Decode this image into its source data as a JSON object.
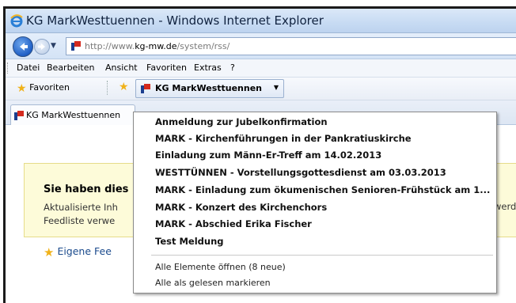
{
  "window": {
    "title": "KG MarkWesttuennen - Windows Internet Explorer"
  },
  "address": {
    "url_prefix": "http://www.",
    "url_host": "kg-mw.de",
    "url_suffix": "/system/rss/"
  },
  "menu": {
    "items": [
      "Datei",
      "Bearbeiten",
      "Ansicht",
      "Favoriten",
      "Extras",
      "?"
    ]
  },
  "favorites_bar": {
    "favorites_label": "Favoriten",
    "feed_button_label": "KG MarkWesttuennen"
  },
  "tabs": [
    {
      "label": "KG MarkWesttuennen"
    }
  ],
  "notice": {
    "title": "Sie haben dies",
    "line1": "Aktualisierte Inh",
    "line2": "Feedliste verwe",
    "right_fragment": "werd"
  },
  "own_feeds_link": "Eigene Fee",
  "feed_dropdown": {
    "items": [
      "Anmeldung zur Jubelkonfirmation",
      "MARK - Kirchenführungen in der Pankratiuskirche",
      "Einladung zum Männ-Er-Treff am 14.02.2013",
      "WESTTÜNNEN - Vorstellungsgottesdienst am 03.03.2013",
      "MARK - Einladung zum ökumenischen Senioren-Frühstück am 1...",
      "MARK - Konzert des Kirchenchors",
      "MARK - Abschied Erika Fischer",
      "Test Meldung"
    ],
    "open_all": "Alle Elemente öffnen (8 neue)",
    "mark_all_read": "Alle als gelesen markieren"
  },
  "colors": {
    "brand_red": "#d42a1e",
    "titlebar": "#c7dbf3",
    "notice_bg": "#fdfbd9",
    "link_blue": "#1a4a8c"
  }
}
